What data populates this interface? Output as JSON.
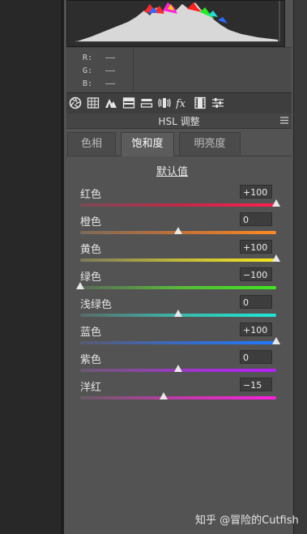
{
  "info": {
    "labels": [
      "R:",
      "G:",
      "B:"
    ],
    "values": [
      "——",
      "——",
      "——"
    ]
  },
  "panel": {
    "title": "HSL 调整"
  },
  "tabs": [
    {
      "label": "色相",
      "active": false
    },
    {
      "label": "饱和度",
      "active": true
    },
    {
      "label": "明亮度",
      "active": false
    }
  ],
  "default_button": "默认值",
  "sliders": [
    {
      "label": "红色",
      "value": "+100",
      "level": 100
    },
    {
      "label": "橙色",
      "value": "0",
      "level": 0
    },
    {
      "label": "黄色",
      "value": "+100",
      "level": 100
    },
    {
      "label": "绿色",
      "value": "−100",
      "level": -100
    },
    {
      "label": "浅绿色",
      "value": "0",
      "level": 0
    },
    {
      "label": "蓝色",
      "value": "+100",
      "level": 100
    },
    {
      "label": "紫色",
      "value": "0",
      "level": 0
    },
    {
      "label": "洋红",
      "value": "−15",
      "level": -15
    }
  ],
  "slider_gradients": [
    "linear-gradient(to right,#7a4a55,#c02a4a,#ff1e4e)",
    "linear-gradient(to right,#7a6a5a,#c0703a,#ff8a1e)",
    "linear-gradient(to right,#7a7a5a,#c0b83a,#f5e81e)",
    "linear-gradient(to right,#5a6a5a,#5ab83a,#3ee81e)",
    "linear-gradient(to right,#5a6a6a,#3ab8a8,#1ee8d8)",
    "linear-gradient(to right,#5a5a70,#3a6ac0,#1e78ff)",
    "linear-gradient(to right,#6a5a70,#9a3ac0,#b81eff)",
    "linear-gradient(to right,#6a5a66,#c03aa8,#ff1ee0)"
  ],
  "toolbar_icons": [
    "aperture-icon",
    "grid-icon",
    "mountain-icon",
    "split-tone-icon",
    "detail-icon",
    "lens-icon",
    "fx-icon",
    "camera-calibration-icon",
    "sliders-icon"
  ],
  "watermark": "知乎 @冒险的Cutfish"
}
